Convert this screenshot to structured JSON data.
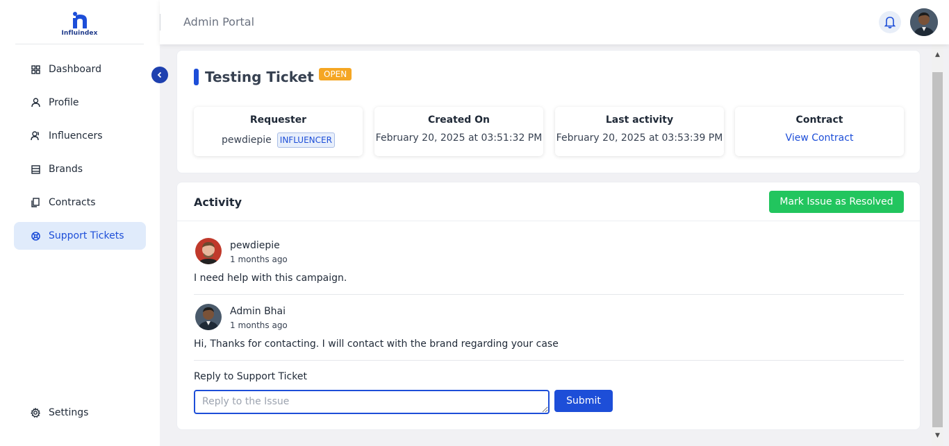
{
  "brand": {
    "name": "Influindex"
  },
  "sidebar": {
    "items": [
      {
        "label": "Dashboard",
        "icon": "grid-icon",
        "active": false
      },
      {
        "label": "Profile",
        "icon": "user-icon",
        "active": false
      },
      {
        "label": "Influencers",
        "icon": "users-icon",
        "active": false
      },
      {
        "label": "Brands",
        "icon": "store-icon",
        "active": false
      },
      {
        "label": "Contracts",
        "icon": "file-icon",
        "active": false
      },
      {
        "label": "Support Tickets",
        "icon": "support-icon",
        "active": true
      }
    ],
    "settings_label": "Settings"
  },
  "header": {
    "title": "Admin Portal"
  },
  "ticket": {
    "title": "Testing Ticket",
    "status": "OPEN",
    "requester": {
      "label": "Requester",
      "name": "pewdiepie",
      "role": "INFLUENCER"
    },
    "created": {
      "label": "Created On",
      "value": "February 20, 2025 at 03:51:32 PM"
    },
    "last_activity": {
      "label": "Last activity",
      "value": "February 20, 2025 at 03:53:39 PM"
    },
    "contract": {
      "label": "Contract",
      "link": "View Contract"
    }
  },
  "activity": {
    "title": "Activity",
    "resolve_label": "Mark Issue as Resolved",
    "messages": [
      {
        "name": "pewdiepie",
        "time": "1 months ago",
        "text": "I need help with this campaign."
      },
      {
        "name": "Admin Bhai",
        "time": "1 months ago",
        "text": "Hi, Thanks for contacting. I will contact with the brand regarding your case"
      }
    ],
    "reply": {
      "label": "Reply to Support Ticket",
      "placeholder": "Reply to the Issue",
      "value": "",
      "submit_label": "Submit"
    }
  },
  "colors": {
    "accent": "#1d4ed8",
    "status_open": "#f5a623",
    "success": "#22c55e",
    "active_nav_bg": "#e0ebfb"
  }
}
